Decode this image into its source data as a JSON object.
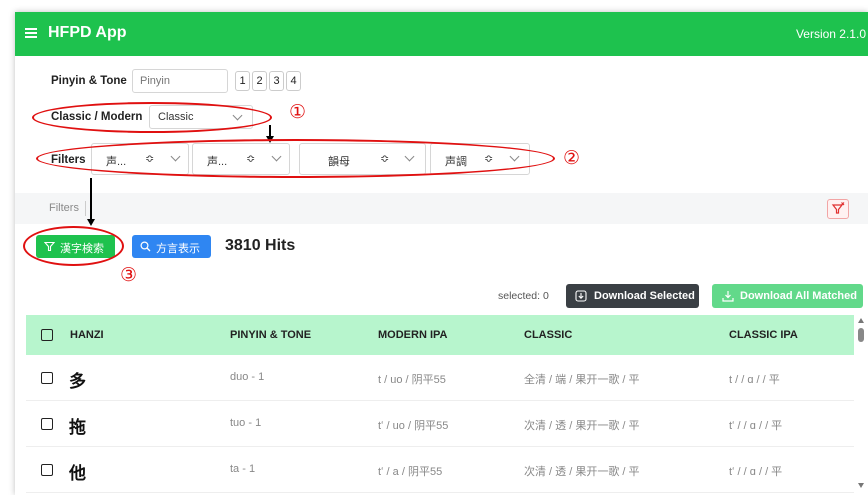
{
  "header": {
    "title": "HFPD App",
    "version": "Version 2.1.0"
  },
  "pinyin": {
    "label": "Pinyin & Tone",
    "placeholder": "Pinyin",
    "tones": [
      "1",
      "2",
      "3",
      "4"
    ]
  },
  "mode": {
    "label": "Classic / Modern",
    "selected": "Classic"
  },
  "filters": {
    "label": "Filters",
    "selects": [
      "声...",
      "声...",
      "韻母",
      "声調"
    ]
  },
  "filters_bar": {
    "label": "Filters"
  },
  "actions": {
    "search_label": "漢字検索",
    "dialect_label": "方言表示",
    "hits": "3810 Hits"
  },
  "annotations": {
    "one": "①",
    "two": "②",
    "three": "③"
  },
  "download": {
    "selected_text": "selected: 0",
    "download_selected": "Download Selected",
    "download_all": "Download All Matched"
  },
  "table": {
    "columns": [
      "HANZI",
      "PINYIN & TONE",
      "MODERN IPA",
      "CLASSIC",
      "CLASSIC IPA"
    ],
    "rows": [
      {
        "hanzi": "多",
        "pinyin": "duo - 1",
        "modern_ipa": "t / uo / 阴平55",
        "classic": "全清 / 端 / 果开一歌 / 平",
        "classic_ipa": "t / / ɑ / / 平"
      },
      {
        "hanzi": "拖",
        "pinyin": "tuo - 1",
        "modern_ipa": "tʻ / uo / 阴平55",
        "classic": "次清 / 透 / 果开一歌 / 平",
        "classic_ipa": "tʻ / / ɑ / / 平"
      },
      {
        "hanzi": "他",
        "pinyin": "ta - 1",
        "modern_ipa": "tʻ / a / 阴平55",
        "classic": "次清 / 透 / 果开一歌 / 平",
        "classic_ipa": "tʻ / / ɑ / / 平"
      }
    ]
  },
  "colors": {
    "primary": "#1ec24e",
    "table_header": "#b7f5cd",
    "blue_button": "#2f86f2",
    "dark_button": "#3a3f44",
    "light_green_button": "#62d98a",
    "annotation_red": "#e01010"
  }
}
